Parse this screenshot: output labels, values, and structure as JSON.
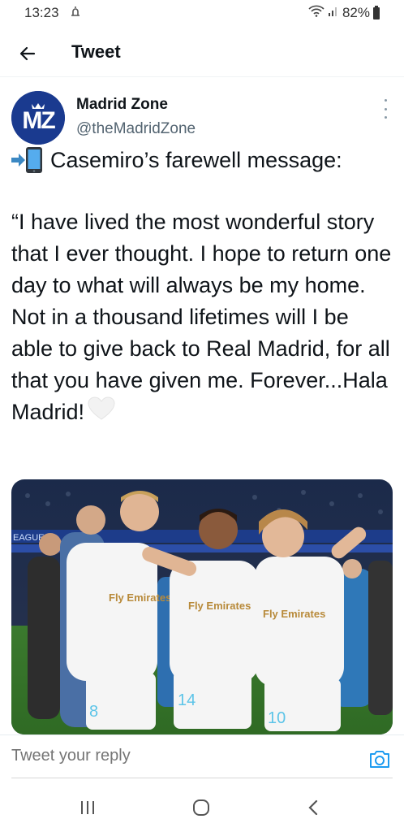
{
  "status_bar": {
    "time": "13:23",
    "battery": "82%"
  },
  "header": {
    "title": "Tweet"
  },
  "author": {
    "avatar_text": "MZ",
    "display_name": "Madrid Zone",
    "handle": "@theMadridZone"
  },
  "tweet": {
    "line1": "Casemiro’s farewell message:",
    "body": "“I have lived the most wonderful story that I ever thought. I hope to return one day to what will always be my home. Not in a thousand lifetimes will I be able to give back to Real Madrid, for all that you have given me. Forever...Hala Madrid!",
    "media": {
      "board_text": "EAGUE",
      "shirt_sponsor": "Fly Emirates",
      "numbers": [
        "8",
        "14",
        "10"
      ]
    }
  },
  "reply": {
    "placeholder": "Tweet your reply"
  },
  "icons": {
    "back": "arrow-left-icon",
    "more": "more-vertical-icon",
    "camera": "camera-icon",
    "heart": "white-heart-icon",
    "phone": "mobile-phone-arrow-icon"
  },
  "colors": {
    "brand_blue": "#1d9bf0",
    "avatar_bg": "#1a3a8f"
  }
}
